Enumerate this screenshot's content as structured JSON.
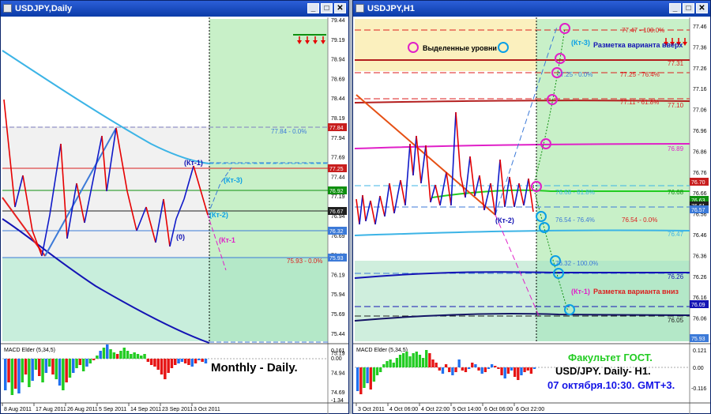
{
  "colors": {
    "up": "#0f19c8",
    "down": "#e60000",
    "ma_light": "#3cb4e6",
    "ma_dark": "#1414b4",
    "ma_green": "#109010",
    "fib_red": "#dc1e1e",
    "fib_blue": "#3c7ad8",
    "magenta": "#e020c8",
    "cyan_circle": "#0aa0e6",
    "green_zone": "#c8f0c8",
    "yellow_zone": "#fbf0be",
    "macd_green": "#22cc22",
    "macd_red": "#e61414",
    "macd_blue": "#2070f0"
  },
  "window_buttons": {
    "minimize": "_",
    "maximize": "□",
    "close": "✕"
  },
  "left": {
    "title": "USDJPY,Daily",
    "price_ticks": [
      "79.44",
      "79.19",
      "78.94",
      "78.69",
      "78.44",
      "78.19",
      "77.94",
      "77.69",
      "77.44",
      "77.19",
      "76.94",
      "76.69",
      "76.44",
      "76.19",
      "75.94",
      "75.69",
      "75.44",
      "75.19",
      "74.94",
      "74.69"
    ],
    "tags": [
      {
        "text": "77.84",
        "bg": "#c81e1e"
      },
      {
        "text": "77.25",
        "bg": "#c81e1e"
      },
      {
        "text": "76.92",
        "bg": "#109010"
      },
      {
        "text": "76.67",
        "bg": "#202020"
      },
      {
        "text": "76.32",
        "bg": "#3c7ad8"
      },
      {
        "text": "75.93",
        "bg": "#3c7ad8"
      }
    ],
    "labels": {
      "fib_top": "77.84 - 0.0%",
      "fib_bottom": "75.93 - 0.0%",
      "kt1": "(Кт-1)",
      "kt2": "(Кт-2)",
      "kt3": "(Кт-3)",
      "kt1b": "(Кт-1",
      "zero": "(0)",
      "caption": "Monthly - Daily."
    },
    "macd": {
      "title": "MACD Elder (5,34,5)",
      "ticks": [
        "0.161",
        "0.00",
        "-1.34"
      ]
    },
    "dates": [
      "8 Aug 2011",
      "17 Aug 2011",
      "26 Aug 2011",
      "5 Sep 2011",
      "14 Sep 2011",
      "23 Sep 2011",
      "3 Oct 2011"
    ]
  },
  "right": {
    "title": "USDJPY,H1",
    "price_ticks": [
      "77.46",
      "77.36",
      "77.26",
      "77.16",
      "77.06",
      "76.96",
      "76.86",
      "76.76",
      "76.66",
      "76.56",
      "76.46",
      "76.36",
      "76.26",
      "76.16",
      "76.06"
    ],
    "tags": [
      {
        "text": "76.70",
        "bg": "#c81e1e"
      },
      {
        "text": "76.63",
        "bg": "#109010"
      },
      {
        "text": "76.61",
        "bg": "#202020"
      },
      {
        "text": "76.57",
        "bg": "#3c7ad8"
      },
      {
        "text": "76.09",
        "bg": "#1414b4"
      },
      {
        "text": "75.93",
        "bg": "#3c7ad8"
      }
    ],
    "labels": {
      "legend": "Выделенные уровни",
      "kt3": "(Кт-3)",
      "up_variant": "Разметка варианта вверх",
      "kt2": "(Кт-2)",
      "kt1": "(Кт-1)",
      "down_variant": "Разметка варианта вниз",
      "fib_top": "77.47 - 100.0%",
      "l7731": "77.31",
      "fib_mid_a": "77.25 - 0.0%",
      "fib_mid_b": "77.25 - 76.4%",
      "fib_618": "77.11 - 61.8%",
      "l7710": "77.10",
      "l7689": "76.89",
      "fib_68": "76.68 - 61.8%",
      "l7668": "76.68",
      "fib_54a": "76.54 - 76.4%",
      "fib_54b": "76.54 - 0.0%",
      "l7647": "76.47",
      "fib_32": "76.32 - 100.0%",
      "l7626": "76.26",
      "l7605": "76.05"
    },
    "caption": {
      "line1": "Факультет ГОСТ.",
      "line2": "USD/JPY. Daily- H1.",
      "line3": "07 октября.10:30. GMT+3."
    },
    "macd": {
      "title": "MACD Elder (5,34,5)",
      "ticks": [
        "0.121",
        "0.00",
        "-0.116"
      ]
    },
    "dates": [
      "3 Oct 2011",
      "4 Oct 06:00",
      "4 Oct 22:00",
      "5 Oct 14:00",
      "6 Oct 06:00",
      "6 Oct 22:00"
    ]
  }
}
